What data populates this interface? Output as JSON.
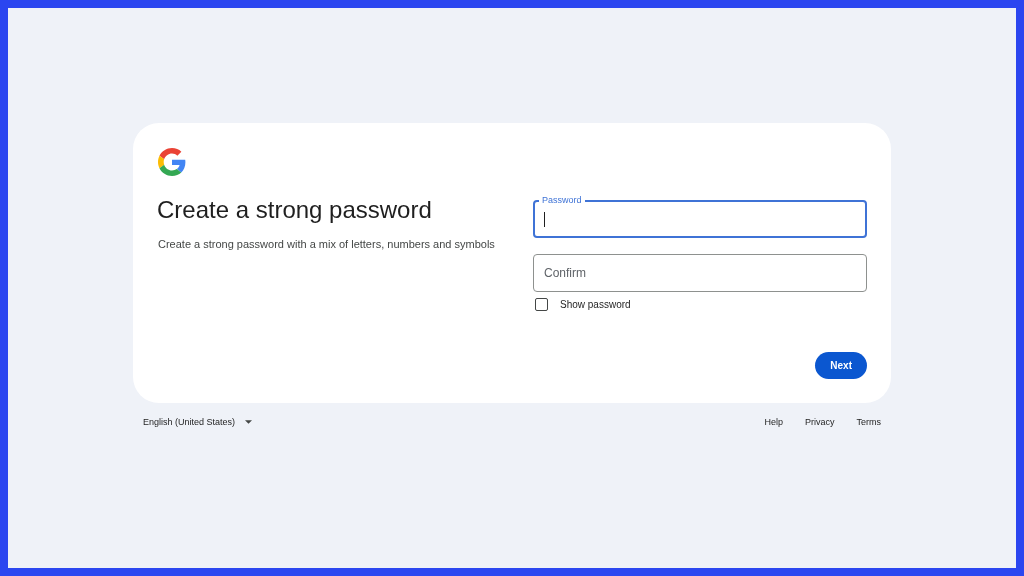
{
  "card": {
    "heading": "Create a strong password",
    "subtitle": "Create a strong password with a mix of letters, numbers and symbols",
    "password_field": {
      "label": "Password",
      "focused": true
    },
    "confirm_field": {
      "placeholder": "Confirm",
      "focused": false
    },
    "show_password": {
      "label": "Show password",
      "checked": false
    },
    "next_button": "Next"
  },
  "footer": {
    "language": "English (United States)",
    "links": [
      "Help",
      "Privacy",
      "Terms"
    ]
  }
}
